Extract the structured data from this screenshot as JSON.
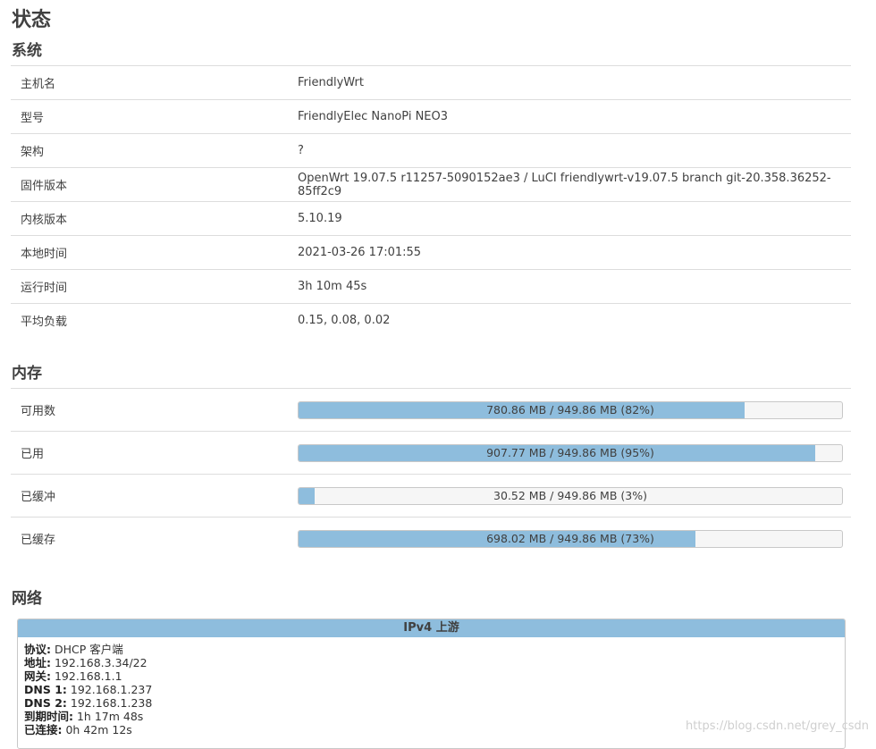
{
  "page": {
    "title": "状态"
  },
  "system": {
    "title": "系统",
    "rows": [
      {
        "label": "主机名",
        "value": "FriendlyWrt"
      },
      {
        "label": "型号",
        "value": "FriendlyElec NanoPi NEO3"
      },
      {
        "label": "架构",
        "value": "?"
      },
      {
        "label": "固件版本",
        "value": "OpenWrt 19.07.5 r11257-5090152ae3 / LuCI friendlywrt-v19.07.5 branch git-20.358.36252-85ff2c9"
      },
      {
        "label": "内核版本",
        "value": "5.10.19"
      },
      {
        "label": "本地时间",
        "value": "2021-03-26 17:01:55"
      },
      {
        "label": "运行时间",
        "value": "3h 10m 45s"
      },
      {
        "label": "平均负载",
        "value": "0.15, 0.08, 0.02"
      }
    ]
  },
  "memory": {
    "title": "内存",
    "rows": [
      {
        "label": "可用数",
        "text": "780.86 MB / 949.86 MB (82%)",
        "percent": 82
      },
      {
        "label": "已用",
        "text": "907.77 MB / 949.86 MB (95%)",
        "percent": 95
      },
      {
        "label": "已缓冲",
        "text": "30.52 MB / 949.86 MB (3%)",
        "percent": 3
      },
      {
        "label": "已缓存",
        "text": "698.02 MB / 949.86 MB (73%)",
        "percent": 73
      }
    ]
  },
  "network": {
    "title": "网络",
    "ipv4": {
      "header": "IPv4 上游",
      "lines": [
        {
          "key": "协议:",
          "value": " DHCP 客户端"
        },
        {
          "key": "地址:",
          "value": " 192.168.3.34/22"
        },
        {
          "key": "网关:",
          "value": " 192.168.1.1"
        },
        {
          "key": "DNS 1:",
          "value": " 192.168.1.237"
        },
        {
          "key": "DNS 2:",
          "value": " 192.168.1.238"
        },
        {
          "key": "到期时间:",
          "value": " 1h 17m 48s"
        },
        {
          "key": "已连接:",
          "value": " 0h 42m 12s"
        }
      ]
    }
  },
  "watermark": "https://blog.csdn.net/grey_csdn",
  "colors": {
    "bar_fill": "#8ebddd",
    "panel_header": "#8ebddd"
  }
}
